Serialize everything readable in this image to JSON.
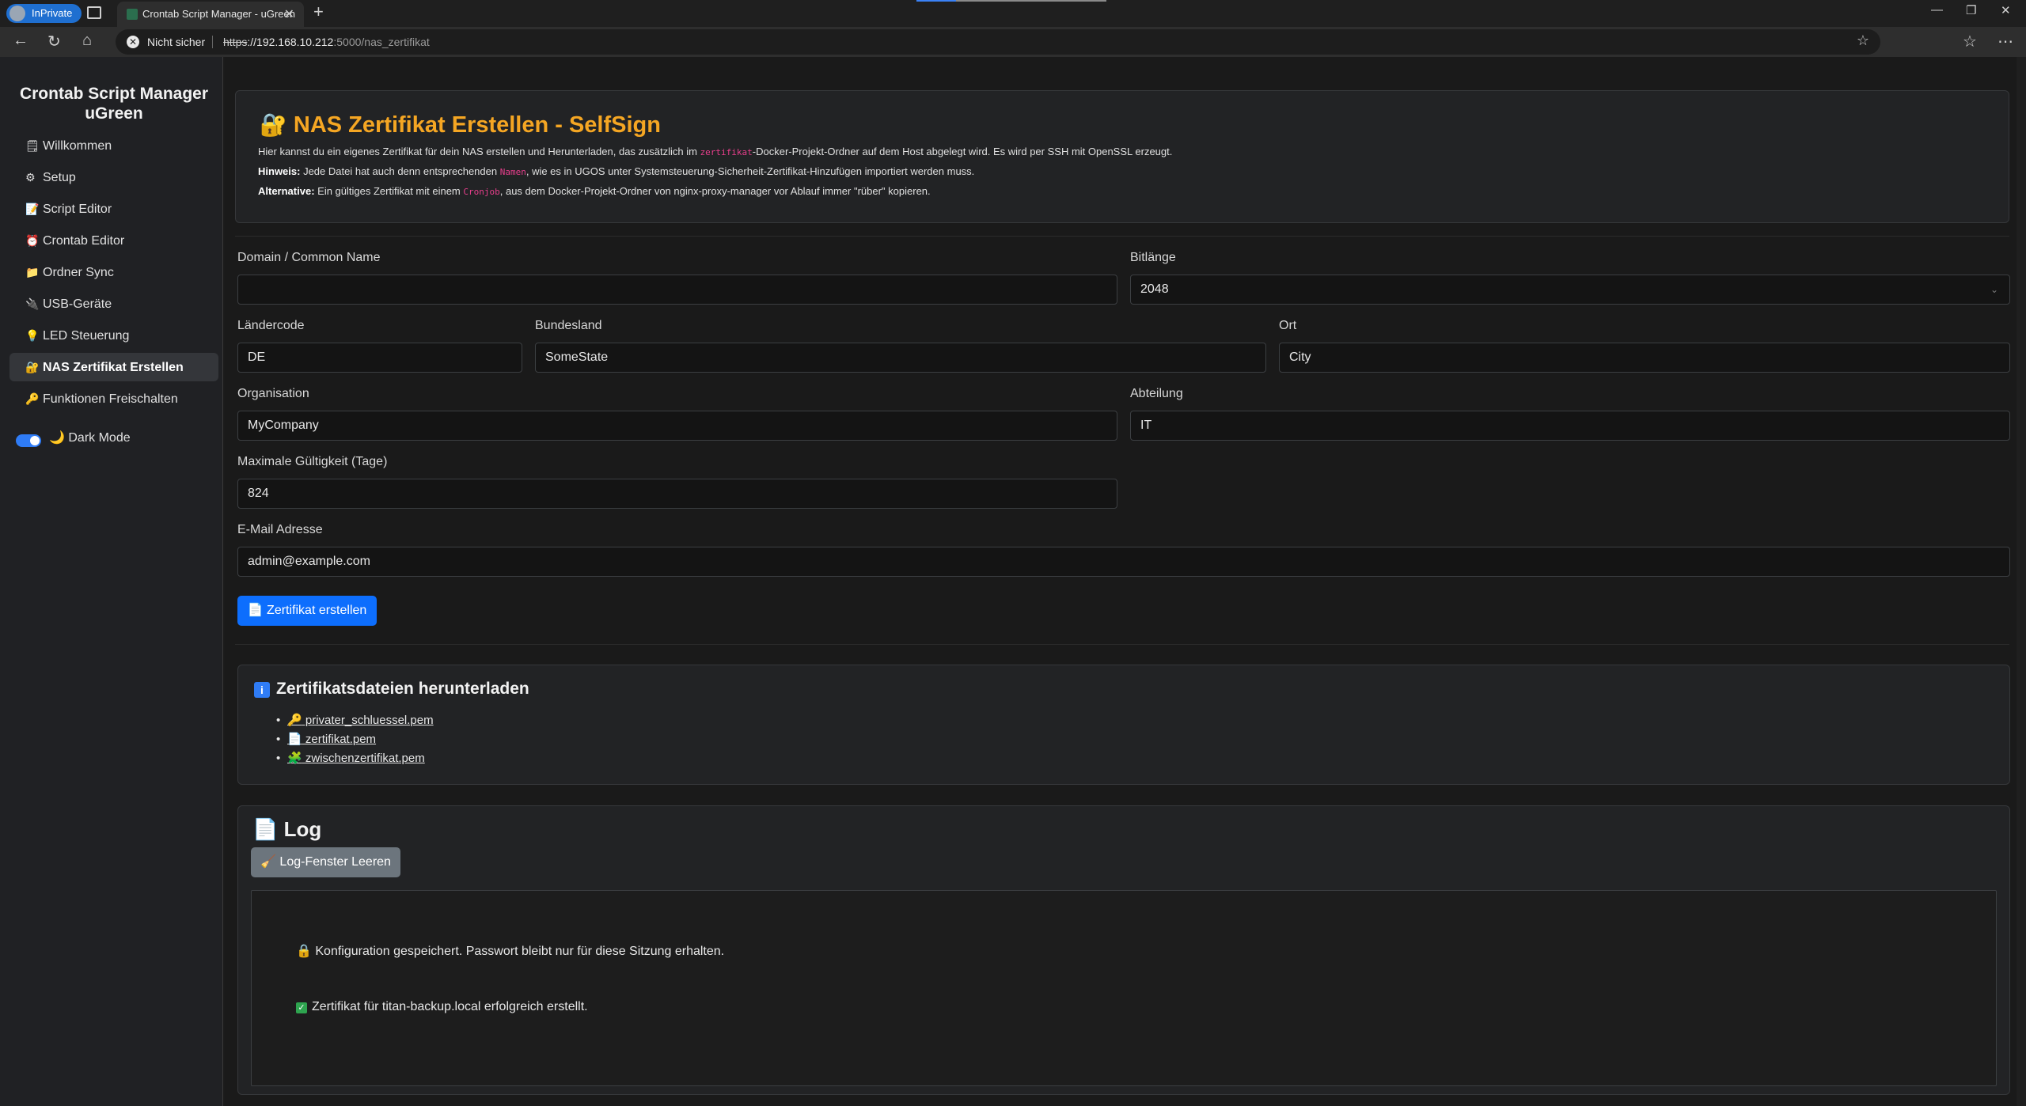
{
  "browser": {
    "inprivate_label": "InPrivate",
    "tab_title": "Crontab Script Manager - uGreen",
    "tab_close": "✕",
    "new_tab": "+",
    "security_warning": "Nicht sicher",
    "url_scheme": "https",
    "url_host": "://192.168.10.212",
    "url_rest": ":5000/nas_zertifikat"
  },
  "sidebar": {
    "brand": "Crontab Script Manager uGreen",
    "items": [
      {
        "icon": "🗒",
        "label": "Willkommen"
      },
      {
        "icon": "⚙",
        "label": "Setup"
      },
      {
        "icon": "📝",
        "label": "Script Editor"
      },
      {
        "icon": "⏰",
        "label": "Crontab Editor"
      },
      {
        "icon": "📁",
        "label": "Ordner Sync"
      },
      {
        "icon": "🔌",
        "label": "USB-Geräte"
      },
      {
        "icon": "💡",
        "label": "LED Steuerung"
      },
      {
        "icon": "🔐",
        "label": "NAS Zertifikat Erstellen"
      },
      {
        "icon": "🔑",
        "label": "Funktionen Freischalten"
      }
    ],
    "dark_mode_icon": "🌙",
    "dark_mode_label": "Dark Mode"
  },
  "header": {
    "icon": "🔐",
    "title": "NAS Zertifikat Erstellen - SelfSign",
    "line1_a": "Hier kannst du ein eigenes Zertifikat für dein NAS erstellen und Herunterladen, das zusätzlich im ",
    "line1_code": "zertifikat",
    "line1_b": "-Docker-Projekt-Ordner auf dem Host abgelegt wird. Es wird per SSH mit OpenSSL erzeugt.",
    "line2_bold": "Hinweis:",
    "line2_a": " Jede Datei hat auch denn entsprechenden ",
    "line2_code": "Namen",
    "line2_b": ", wie es in UGOS unter Systemsteuerung-Sicherheit-Zertifikat-Hinzufügen importiert werden muss.",
    "line3_bold": "Alternative:",
    "line3_a": " Ein gültiges Zertifikat mit einem ",
    "line3_code": "Cronjob",
    "line3_b": ", aus dem Docker-Projekt-Ordner von nginx-proxy-manager vor Ablauf immer \"rüber\" kopieren."
  },
  "form": {
    "domain_label": "Domain / Common Name",
    "domain_value": "",
    "bitlength_label": "Bitlänge",
    "bitlength_value": "2048",
    "country_label": "Ländercode",
    "country_value": "DE",
    "state_label": "Bundesland",
    "state_value": "SomeState",
    "city_label": "Ort",
    "city_value": "City",
    "org_label": "Organisation",
    "org_value": "MyCompany",
    "dept_label": "Abteilung",
    "dept_value": "IT",
    "validity_label": "Maximale Gültigkeit (Tage)",
    "validity_value": "824",
    "email_label": "E-Mail Adresse",
    "email_value": "admin@example.com",
    "submit_label": "📄 Zertifikat erstellen"
  },
  "downloads": {
    "title": "Zertifikatsdateien herunterladen",
    "info_icon": "i",
    "files": [
      {
        "icon": "🔑",
        "name": " privater_schluessel.pem"
      },
      {
        "icon": "📄",
        "name": " zertifikat.pem"
      },
      {
        "icon": "🧩",
        "name": " zwischenzertifikat.pem"
      }
    ]
  },
  "log": {
    "icon": "📄",
    "title": "Log",
    "clear_label": "🧹 Log-Fenster Leeren",
    "lines": [
      {
        "icon": "🔒",
        "text": "Konfiguration gespeichert. Passwort bleibt nur für diese Sitzung erhalten."
      },
      {
        "icon": "✓",
        "text": "Zertifikat für titan-backup.local erfolgreich erstellt."
      }
    ]
  }
}
